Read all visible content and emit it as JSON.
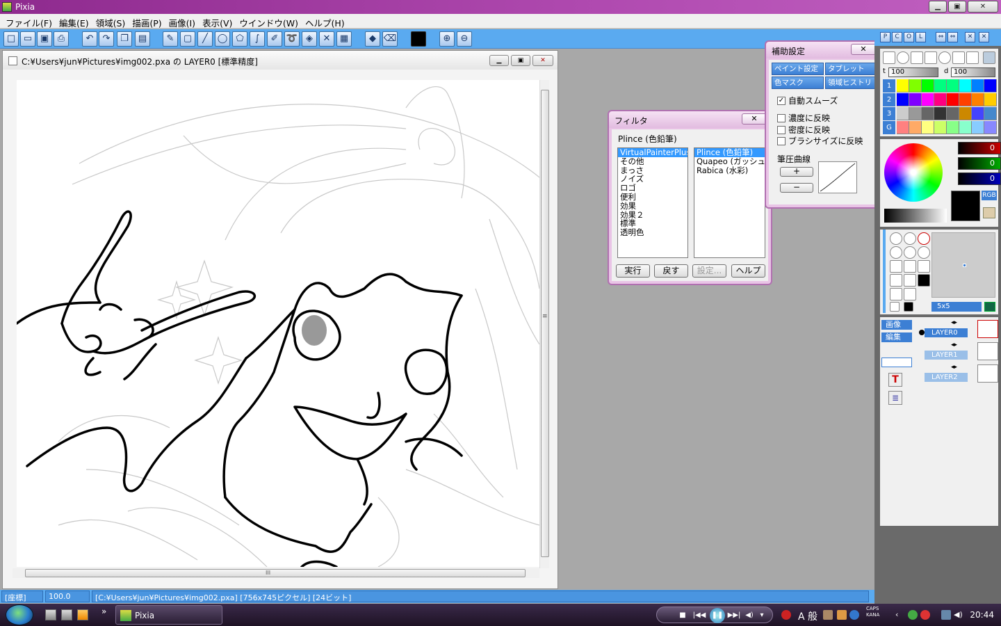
{
  "app": {
    "title": "Pixia",
    "window_buttons": {
      "minimize": "▁",
      "maximize": "▣",
      "close": "✕"
    }
  },
  "menu": [
    "ファイル(F)",
    "編集(E)",
    "領域(S)",
    "描画(P)",
    "画像(I)",
    "表示(V)",
    "ウインドウ(W)",
    "ヘルプ(H)"
  ],
  "toolbar": {
    "icons": [
      "new-icon",
      "open-icon",
      "save-icon",
      "print-icon",
      "undo-icon",
      "redo-icon",
      "copy-icon",
      "paste-icon",
      "pencil-icon",
      "rectangle-icon",
      "line-icon",
      "ellipse-icon",
      "polygon-icon",
      "curve-icon",
      "brush-icon",
      "lasso-icon",
      "fill-icon",
      "clear-icon",
      "pattern-icon",
      "stamp-icon",
      "eraser-icon",
      "color-swatch-icon",
      "zoom-in-icon",
      "zoom-out-icon"
    ]
  },
  "canvas_window": {
    "title": "C:¥Users¥jun¥Pictures¥img002.pxa の LAYER0 [標準精度]",
    "scroll_grip": "≡",
    "hscroll_grip": "III"
  },
  "status": {
    "coord_label": "[座標]",
    "zoom": "100.0",
    "info": "[C:¥Users¥jun¥Pictures¥img002.pxa] [756x745ピクセル] [24ビット]"
  },
  "filter_dialog": {
    "title": "フィルタ",
    "close": "✕",
    "current": "Plince (色鉛筆)",
    "categories": [
      "VirtualPainterPlus",
      "その他",
      "まっさ",
      "ノイズ",
      "ロゴ",
      "便利",
      "効果",
      "効果２",
      "標準",
      "透明色"
    ],
    "selected_category": 0,
    "filters": [
      "Plince (色鉛筆)",
      "Quapeo (ガッシュ)",
      "Rabica (水彩)"
    ],
    "selected_filter": 0,
    "buttons": {
      "run": "実行",
      "back": "戻す",
      "settings": "設定...",
      "help": "ヘルプ"
    }
  },
  "assist_dialog": {
    "title": "補助設定",
    "close": "✕",
    "tabs": [
      "ペイント設定",
      "タブレット",
      "色マスク",
      "領域ヒストリ"
    ],
    "checkboxes": [
      {
        "label": "自動スムーズ",
        "checked": true,
        "mark": "✓"
      },
      {
        "label": "濃度に反映",
        "checked": false,
        "mark": ""
      },
      {
        "label": "密度に反映",
        "checked": false,
        "mark": ""
      },
      {
        "label": "ブラシサイズに反映",
        "checked": false,
        "mark": ""
      }
    ],
    "curve_label": "筆圧曲線",
    "plus": "+",
    "minus": "−"
  },
  "right_panel": {
    "top_buttons": [
      "P",
      "C",
      "O",
      "L",
      "⇔",
      "⇔",
      "✕",
      "✕"
    ],
    "t_label": "t",
    "t_value": "100",
    "d_label": "d",
    "d_value": "100",
    "palette_rows": [
      "1",
      "2",
      "3",
      "G"
    ],
    "palette_colors": [
      [
        "#ffff00",
        "#80ff00",
        "#00ff00",
        "#00ff80",
        "#00ff80",
        "#00ffff",
        "#0080ff",
        "#0000ff"
      ],
      [
        "#0000ff",
        "#8000ff",
        "#ff00ff",
        "#ff0080",
        "#ff0000",
        "#ff4000",
        "#ff8000",
        "#ffcc00"
      ],
      [
        "#cccccc",
        "#999999",
        "#666666",
        "#333333",
        "#666666",
        "#cc8800",
        "#4444ff",
        "#4488cc"
      ],
      [
        "#ff8080",
        "#ffaa66",
        "#ffff80",
        "#ccff66",
        "#88ff88",
        "#88ffcc",
        "#88ccff",
        "#8888ff"
      ]
    ],
    "rgb": {
      "r": "0",
      "g": "0",
      "b": "0"
    },
    "rgb_label": "RGB",
    "brush_size": "5x5",
    "side_buttons": {
      "image": "画像",
      "edit": "編集"
    },
    "layers": [
      {
        "name": "LAYER0",
        "active": true
      },
      {
        "name": "LAYER1",
        "active": false
      },
      {
        "name": "LAYER2",
        "active": false
      }
    ]
  },
  "taskbar": {
    "app_label": "Pixia",
    "expand": "»",
    "ime": "A 般",
    "caps": "CAPS",
    "kana": "KANA",
    "clock": "20:44",
    "media": [
      "■",
      "|◀◀",
      "▶▶|",
      "◀)",
      "▾"
    ]
  }
}
